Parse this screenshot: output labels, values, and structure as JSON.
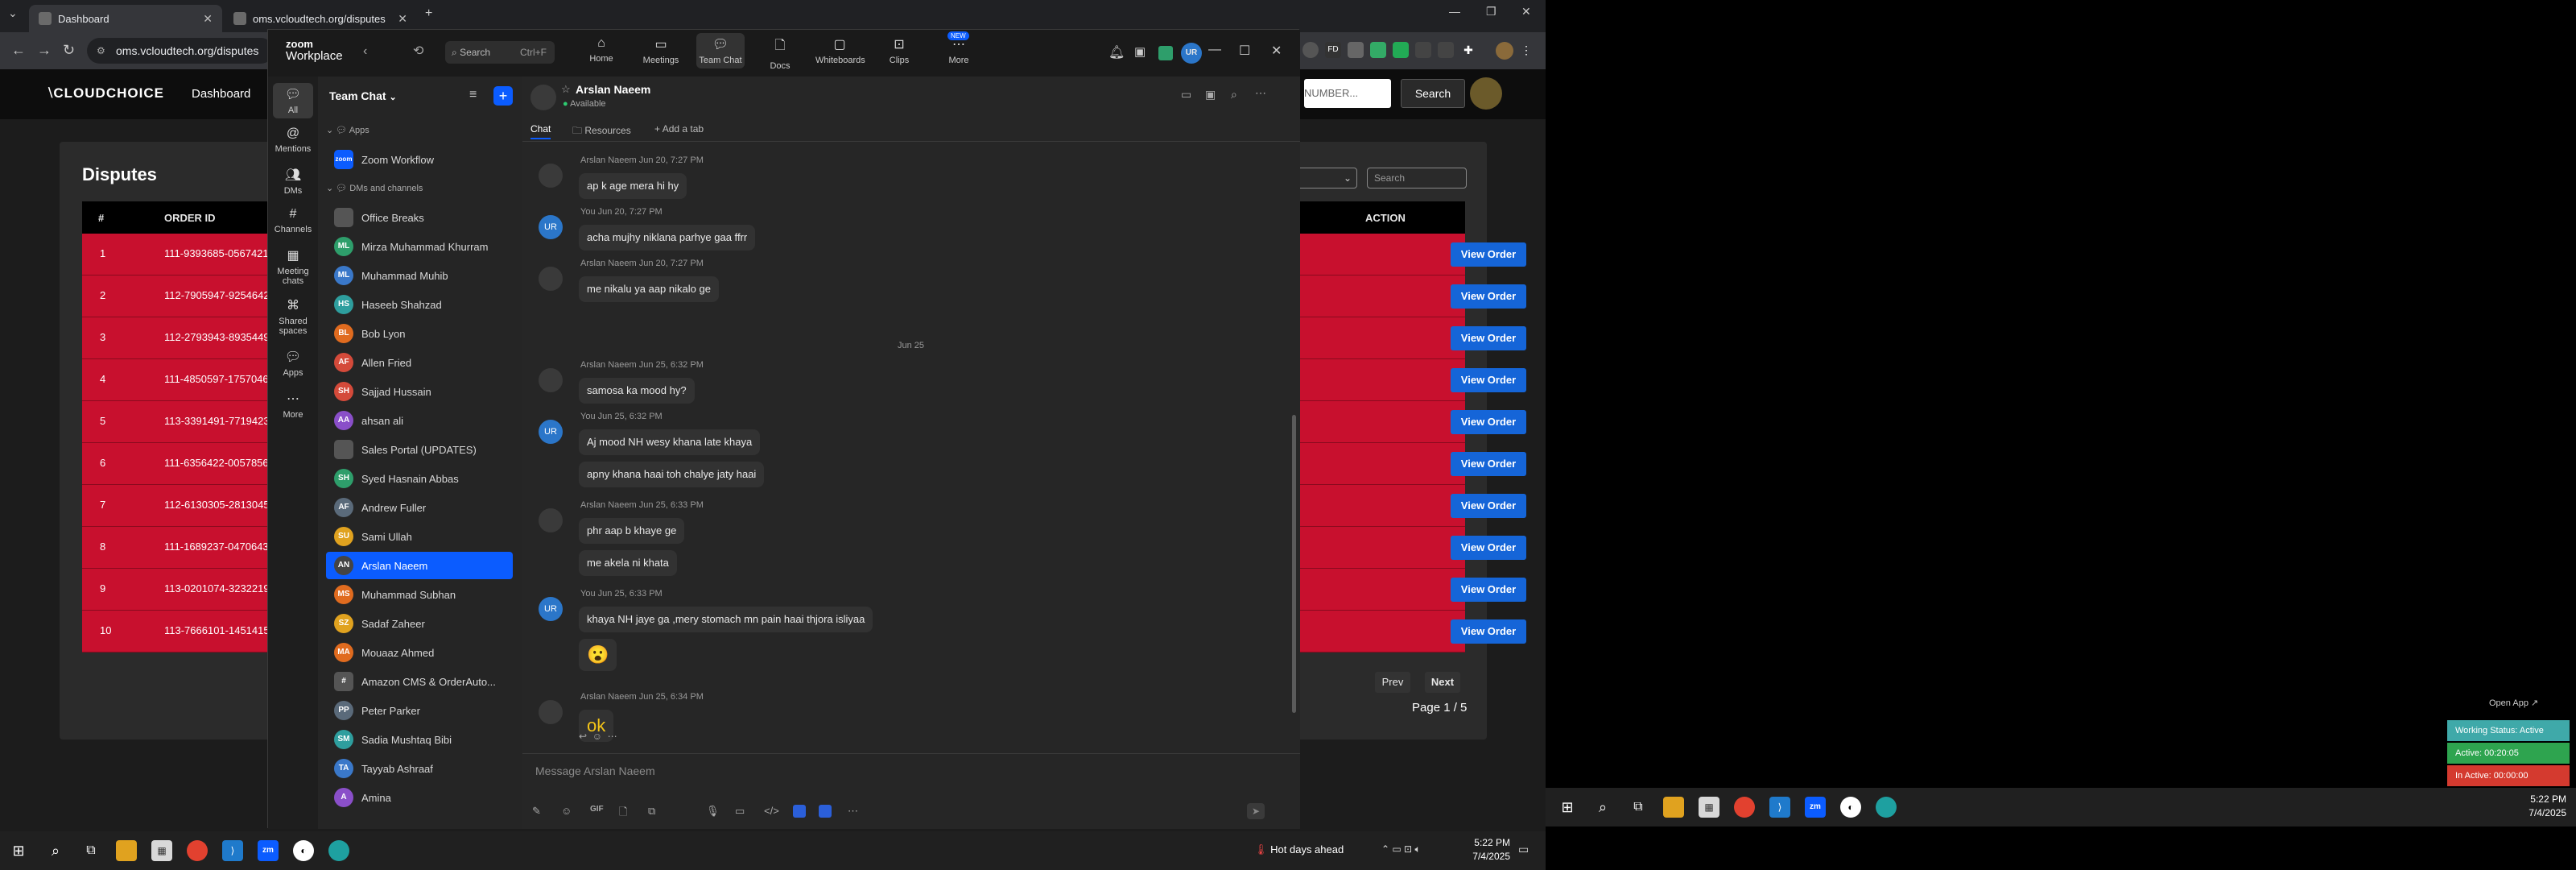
{
  "browser": {
    "tabs": [
      {
        "title": "Dashboard"
      },
      {
        "title": "oms.vcloudtech.org/disputes"
      }
    ],
    "url": "oms.vcloudtech.org/disputes"
  },
  "site": {
    "logo": "CLOUDCHOICE",
    "nav_dashboard": "Dashboard",
    "search_number_placeholder": "NUMBER...",
    "search_button": "Search",
    "page_title": "Disputes",
    "filter_search_placeholder": "Search",
    "table_headers": {
      "num": "#",
      "order_id": "ORDER ID",
      "action": "ACTION"
    },
    "rows": [
      {
        "num": "1",
        "order_id": "111-9393685-0567421",
        "action": "View Order"
      },
      {
        "num": "2",
        "order_id": "112-7905947-9254642",
        "action": "View Order"
      },
      {
        "num": "3",
        "order_id": "112-2793943-8935449",
        "action": "View Order"
      },
      {
        "num": "4",
        "order_id": "111-4850597-1757046",
        "action": "View Order"
      },
      {
        "num": "5",
        "order_id": "113-3391491-7719423",
        "action": "View Order"
      },
      {
        "num": "6",
        "order_id": "111-6356422-0057856",
        "action": "View Order"
      },
      {
        "num": "7",
        "order_id": "112-6130305-2813045",
        "action": "View Order"
      },
      {
        "num": "8",
        "order_id": "111-1689237-0470643",
        "action": "View Order"
      },
      {
        "num": "9",
        "order_id": "113-0201074-3232219",
        "action": "View Order"
      },
      {
        "num": "10",
        "order_id": "113-7666101-1451415",
        "action": "View Order"
      }
    ],
    "prev": "Prev",
    "next": "Next",
    "page_info": "Page 1 / 5"
  },
  "zoom": {
    "brand_top": "zoom",
    "brand_bottom": "Workplace",
    "search_label": "Search",
    "search_shortcut": "Ctrl+F",
    "nav": [
      {
        "label": "Home",
        "icon": "home-icon"
      },
      {
        "label": "Meetings",
        "icon": "video-icon"
      },
      {
        "label": "Team Chat",
        "icon": "chat-icon"
      },
      {
        "label": "Docs",
        "icon": "doc-icon"
      },
      {
        "label": "Whiteboards",
        "icon": "whiteboard-icon"
      },
      {
        "label": "Clips",
        "icon": "clips-icon"
      },
      {
        "label": "More",
        "icon": "more-icon",
        "badge": "NEW"
      }
    ],
    "user_initials": "UR",
    "rail": [
      {
        "label": "All",
        "icon": "all-icon"
      },
      {
        "label": "Mentions",
        "icon": "at-icon"
      },
      {
        "label": "DMs",
        "icon": "dm-icon"
      },
      {
        "label": "Channels",
        "icon": "hash-icon"
      },
      {
        "label": "Meeting chats",
        "icon": "meeting-chat-icon"
      },
      {
        "label": "Shared spaces",
        "icon": "shared-icon"
      },
      {
        "label": "Apps",
        "icon": "apps-icon"
      },
      {
        "label": "More",
        "icon": "more-icon"
      }
    ],
    "list_title": "Team Chat",
    "sections": {
      "apps": "Apps",
      "dms": "DMs and channels"
    },
    "zoom_workflow": "Zoom Workflow",
    "contacts": [
      {
        "name": "Office Breaks",
        "initials": "",
        "color": "#555555"
      },
      {
        "name": "Mirza Muhammad Khurram",
        "initials": "ML",
        "color": "#2e9e6b"
      },
      {
        "name": "Muhammad Muhib",
        "initials": "ML",
        "color": "#3a78c9"
      },
      {
        "name": "Haseeb Shahzad",
        "initials": "HS",
        "color": "#2e9e9e"
      },
      {
        "name": "Bob Lyon",
        "initials": "BL",
        "color": "#e06b1f"
      },
      {
        "name": "Allen Fried",
        "initials": "AF",
        "color": "#d44a3a"
      },
      {
        "name": "Sajjad Hussain",
        "initials": "SH",
        "color": "#d44a3a"
      },
      {
        "name": "ahsan ali",
        "initials": "AA",
        "color": "#8a4fc9"
      },
      {
        "name": "Sales Portal (UPDATES)",
        "initials": "",
        "color": "#555555"
      },
      {
        "name": "Syed Hasnain Abbas",
        "initials": "SH",
        "color": "#2e9e6b"
      },
      {
        "name": "Andrew Fuller",
        "initials": "AF",
        "color": "#5a6a7a"
      },
      {
        "name": "Sami Ullah",
        "initials": "SU",
        "color": "#e0a21f"
      },
      {
        "name": "Arslan Naeem",
        "initials": "AN",
        "color": "#444444",
        "selected": true
      },
      {
        "name": "Muhammad Subhan",
        "initials": "MS",
        "color": "#e06b1f"
      },
      {
        "name": "Sadaf Zaheer",
        "initials": "SZ",
        "color": "#e0a21f"
      },
      {
        "name": "Mouaaz Ahmed",
        "initials": "MA",
        "color": "#e06b1f"
      },
      {
        "name": "Amazon CMS & OrderAuto...",
        "initials": "#",
        "color": "#555555"
      },
      {
        "name": "Peter Parker",
        "initials": "PP",
        "color": "#5a6a7a"
      },
      {
        "name": "Sadia Mushtaq Bibi",
        "initials": "SM",
        "color": "#2e9e9e"
      },
      {
        "name": "Tayyab Ashraaf",
        "initials": "TA",
        "color": "#3a78c9"
      },
      {
        "name": "Amina",
        "initials": "A",
        "color": "#8a4fc9"
      }
    ],
    "chat": {
      "contact_name": "Arslan Naeem",
      "status": "Available",
      "tabs": [
        "Chat",
        "Resources",
        "Add a tab"
      ],
      "messages": [
        {
          "meta": "Arslan Naeem Jun 20, 7:27 PM",
          "lines": [
            "ap k age mera hi hy"
          ],
          "sender": "other"
        },
        {
          "meta": "You Jun 20, 7:27 PM",
          "lines": [
            "acha mujhy niklana parhye gaa ffrr"
          ],
          "sender": "me"
        },
        {
          "meta": "Arslan Naeem Jun 20, 7:27 PM",
          "lines": [
            "me nikalu ya aap nikalo ge"
          ],
          "sender": "other"
        },
        {
          "meta": "Arslan Naeem Jun 25, 6:32 PM",
          "lines": [
            "samosa ka mood hy?"
          ],
          "sender": "other"
        },
        {
          "meta": "You Jun 25, 6:32 PM",
          "lines": [
            "Aj mood NH wesy khana late khaya",
            "apny khana haai toh chalye jaty haai"
          ],
          "sender": "me"
        },
        {
          "meta": "Arslan Naeem Jun 25, 6:33 PM",
          "lines": [
            "phr aap b khaye ge",
            "me akela ni khata"
          ],
          "sender": "other"
        },
        {
          "meta": "You Jun 25, 6:33 PM",
          "lines": [
            "khaya NH jaye ga ,mery stomach mn pain haai thjora isliyaa",
            "😮"
          ],
          "sender": "me"
        },
        {
          "meta": "Arslan Naeem Jun 25, 6:34 PM",
          "lines": [
            "ok"
          ],
          "sender": "other"
        }
      ],
      "date_divider": "Jun 25",
      "composer_placeholder": "Message Arslan Naeem"
    }
  },
  "taskbar1": {
    "time": "5:22 PM",
    "date": "7/4/2025",
    "weather": "Hot days ahead"
  },
  "taskbar2": {
    "time": "5:22 PM",
    "date": "7/4/2025"
  },
  "widget": {
    "open_app": "Open App ↗",
    "working_status": "Working Status: Active",
    "active": "Active: 00:20:05",
    "inactive": "In Active: 00:00:00"
  },
  "colors": {
    "zoom_blue": "#0b5cff",
    "row_red": "#c8102e",
    "view_btn": "#1565d8"
  }
}
